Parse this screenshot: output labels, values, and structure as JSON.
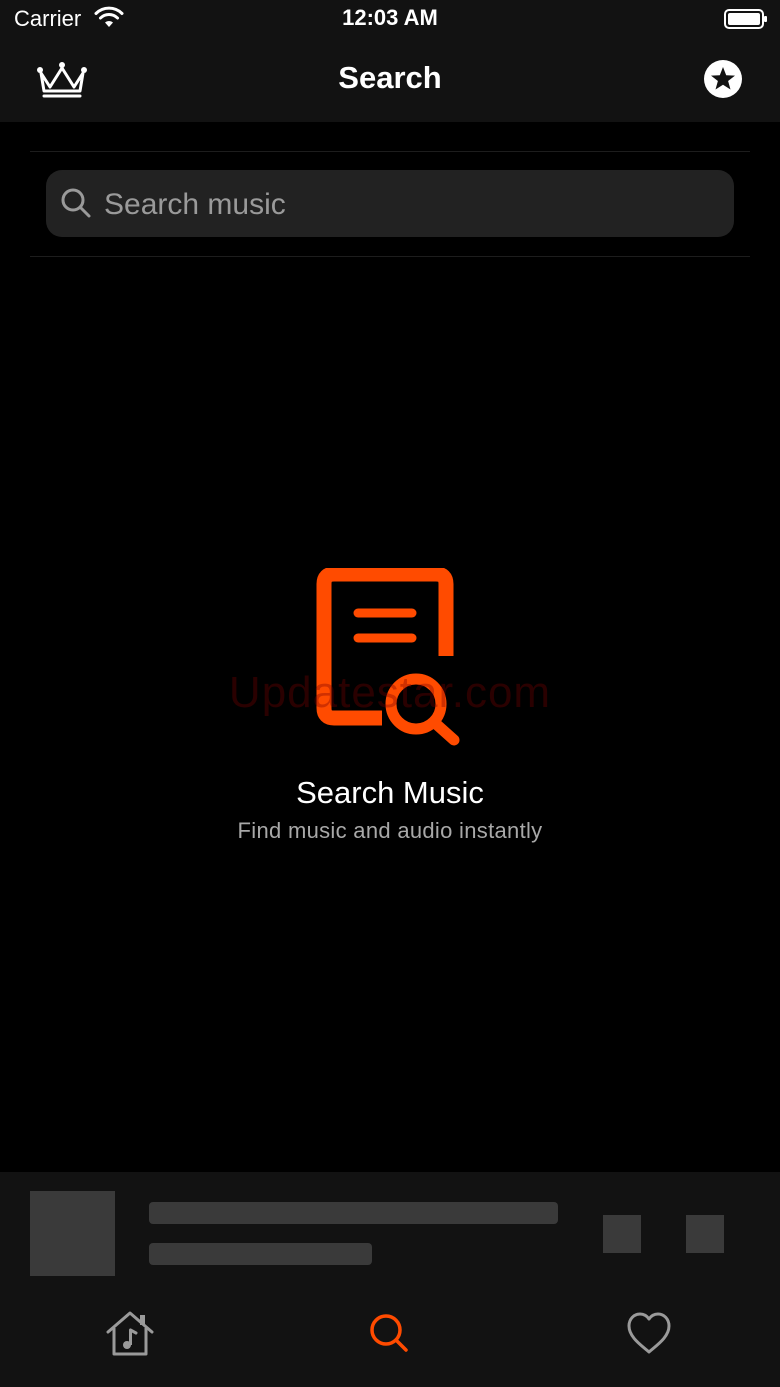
{
  "status_bar": {
    "carrier": "Carrier",
    "time": "12:03 AM"
  },
  "nav": {
    "title": "Search",
    "left_icon": "crown-icon",
    "right_icon": "star-circle-icon"
  },
  "search": {
    "placeholder": "Search music",
    "value": ""
  },
  "empty_state": {
    "icon": "document-search-icon",
    "watermark": "Updatestar.com",
    "title": "Search Music",
    "subtitle": "Find music and audio instantly"
  },
  "tabs": [
    {
      "name": "home",
      "icon": "music-home-icon",
      "selected": false
    },
    {
      "name": "search",
      "icon": "search-icon",
      "selected": true
    },
    {
      "name": "favorites",
      "icon": "heart-icon",
      "selected": false
    }
  ],
  "colors": {
    "accent": "#FF4B00",
    "background": "#000000",
    "bar_background": "#121212",
    "search_field": "#222222",
    "placeholder": "#3A3A3A"
  }
}
